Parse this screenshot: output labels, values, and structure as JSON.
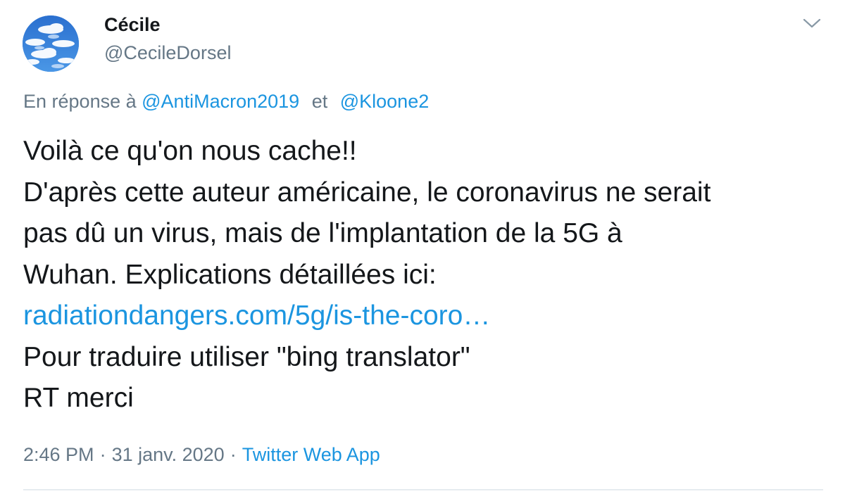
{
  "user": {
    "display_name": "Cécile",
    "handle": "@CecileDorsel",
    "avatar_icon": "cloud-sky-avatar"
  },
  "menu": {
    "icon": "chevron-down-icon"
  },
  "reply": {
    "prefix": "En réponse à",
    "mention_1": "@AntiMacron2019",
    "connector": "et",
    "mention_2": "@Kloone2"
  },
  "tweet": {
    "line_1": "Voilà ce qu'on nous cache!!",
    "line_2": "D'après cette auteur américaine, le coronavirus ne serait",
    "line_3": "pas dû un virus, mais de l'implantation de la 5G à",
    "line_4": "Wuhan. Explications détaillées ici:",
    "link": "radiationdangers.com/5g/is-the-coro…",
    "line_6": "Pour traduire utiliser \"bing translator\"",
    "line_7": "RT merci"
  },
  "meta": {
    "time": "2:46 PM",
    "separator": "·",
    "date": "31 janv. 2020",
    "source": "Twitter Web App"
  },
  "colors": {
    "text": "#14171a",
    "secondary": "#657786",
    "link": "#1b95e0",
    "divider": "#e6ecf0"
  }
}
